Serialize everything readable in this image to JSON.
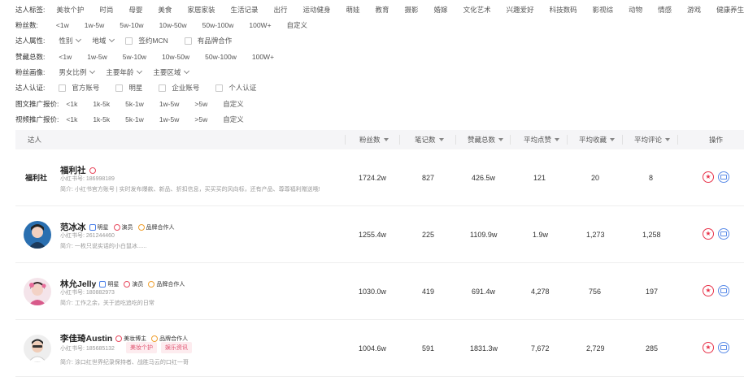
{
  "filters": {
    "category": {
      "label": "达人标签:",
      "options": [
        "美妆个护",
        "时尚",
        "母婴",
        "美食",
        "家居家装",
        "生活记录",
        "出行",
        "运动健身",
        "萌娃",
        "教育",
        "摄影",
        "婚嫁",
        "文化艺术",
        "兴趣爱好",
        "科技数码",
        "影视综",
        "动物",
        "情感",
        "游戏",
        "健康养生"
      ]
    },
    "fans": {
      "label": "粉丝数:",
      "options": [
        "<1w",
        "1w-5w",
        "5w-10w",
        "10w-50w",
        "50w-100w",
        "100W+",
        "自定义"
      ]
    },
    "attributes": {
      "label": "达人属性:",
      "gender": "性别",
      "region": "地域",
      "checks": [
        "签约MCN",
        "有品牌合作"
      ]
    },
    "likes": {
      "label": "赞藏总数:",
      "options": [
        "<1w",
        "1w-5w",
        "5w-10w",
        "10w-50w",
        "50w-100w",
        "100W+"
      ]
    },
    "portrait": {
      "label": "粉丝画像:",
      "selects": [
        "男女比例",
        "主要年龄",
        "主要区域"
      ]
    },
    "auth": {
      "label": "达人认证:",
      "checks": [
        "官方账号",
        "明星",
        "企业账号",
        "个人认证"
      ]
    },
    "image_price": {
      "label": "图文推广报价:",
      "options": [
        "<1k",
        "1k-5k",
        "5k-1w",
        "1w-5w",
        ">5w",
        "自定义"
      ]
    },
    "video_price": {
      "label": "视频推广报价:",
      "options": [
        "<1k",
        "1k-5k",
        "5k-1w",
        "1w-5w",
        ">5w",
        "自定义"
      ]
    }
  },
  "table": {
    "headers": {
      "kol": "达人",
      "fans": "粉丝数",
      "notes": "笔记数",
      "likes_total": "赞藏总数",
      "avg_likes": "平均点赞",
      "avg_collect": "平均收藏",
      "avg_comment": "平均评论",
      "ops": "操作"
    },
    "rows": [
      {
        "logo": "福利社",
        "name": "福利社",
        "badges": [],
        "id_line": "小红书号: 186998189",
        "tags": [],
        "intro": "简介: 小红书官方账号 | 实时发布爆款、新品、折扣信息，买买买的风向标，还有产品、尊尊福利赠送哦!",
        "fans": "1724.2w",
        "notes": "827",
        "likes_total": "426.5w",
        "avg_likes": "121",
        "avg_collect": "20",
        "avg_comment": "8"
      },
      {
        "name": "范冰冰",
        "badges": [
          "明星",
          "演员",
          "品牌合作人"
        ],
        "id_line": "小红书号: 261244460",
        "tags": [],
        "intro": "简介: 一枚只说实话的小白鼠冰......",
        "fans": "1255.4w",
        "notes": "225",
        "likes_total": "1109.9w",
        "avg_likes": "1.9w",
        "avg_collect": "1,273",
        "avg_comment": "1,258"
      },
      {
        "name": "林允Jelly",
        "badges": [
          "明星",
          "演员",
          "品牌合作人"
        ],
        "id_line": "小红书号: 180882973",
        "tags": [],
        "intro": "简介: 工作之余，关于追吃追吃的日常",
        "fans": "1030.0w",
        "notes": "419",
        "likes_total": "691.4w",
        "avg_likes": "4,278",
        "avg_collect": "756",
        "avg_comment": "197"
      },
      {
        "name": "李佳琦Austin",
        "badges": [
          "美妆博主",
          "品牌合作人"
        ],
        "id_line": "小红书号: 185685132",
        "tags": [
          "美妆个护",
          "娱乐资讯"
        ],
        "intro": "简介: 涂口红世界纪录保持者、战胜马云的口红一哥",
        "fans": "1004.6w",
        "notes": "591",
        "likes_total": "1831.3w",
        "avg_likes": "7,672",
        "avg_collect": "2,729",
        "avg_comment": "285"
      }
    ]
  }
}
